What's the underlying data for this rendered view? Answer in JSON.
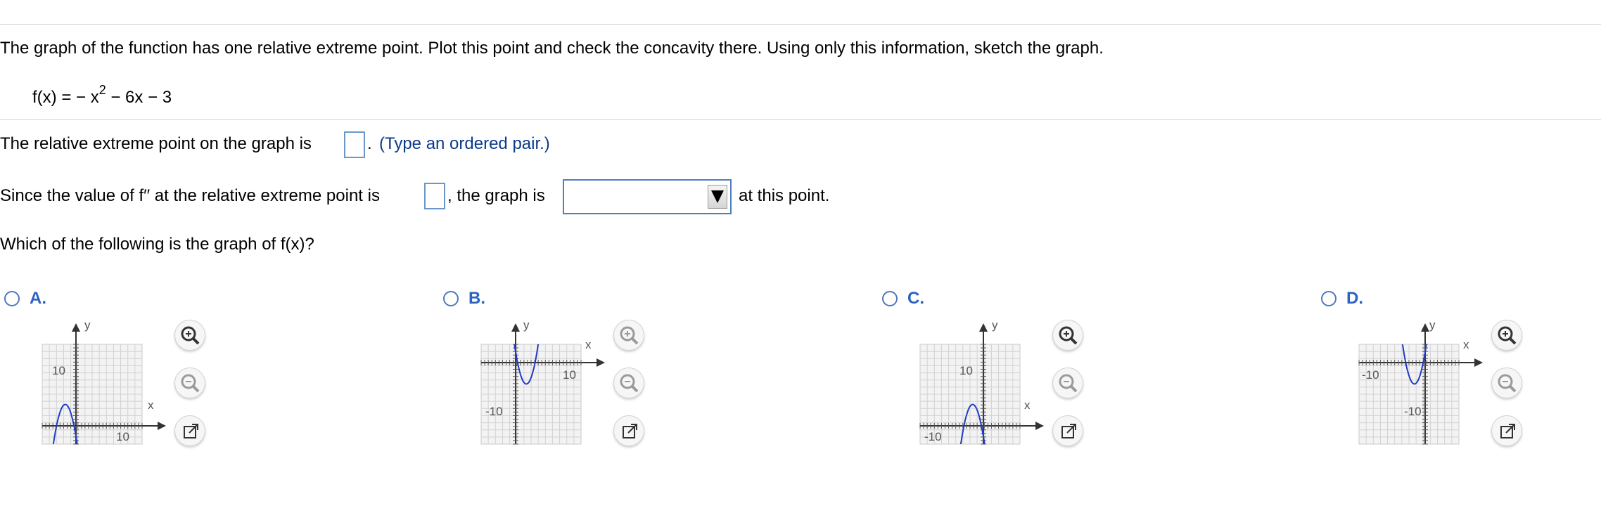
{
  "question": {
    "instructions": "The graph of the function has one relative extreme point. Plot this point and check the concavity there. Using only this information, sketch the graph.",
    "function_prefix": "f(x) =  − x",
    "function_exponent": "2",
    "function_suffix": " − 6x − 3"
  },
  "part1": {
    "prefix": "The relative extreme point on the graph is",
    "suffix": ".",
    "hint": "(Type an ordered pair.)",
    "answer_value": ""
  },
  "part2": {
    "prefix": "Since the value of f′′ at the relative extreme point is",
    "answer_value": "",
    "middle": ", the graph is",
    "dropdown_value": "",
    "suffix": "at this point."
  },
  "part3": {
    "question": "Which of the following is the graph of f(x)?"
  },
  "options": [
    {
      "letter": "A.",
      "x_axis_label": "x",
      "y_axis_label": "y",
      "tick_labels": [
        "10",
        "10"
      ],
      "curve": "down"
    },
    {
      "letter": "B.",
      "x_axis_label": "x",
      "y_axis_label": "y",
      "tick_labels": [
        "10",
        "-10"
      ],
      "curve": "up"
    },
    {
      "letter": "C.",
      "x_axis_label": "x",
      "y_axis_label": "y",
      "tick_labels": [
        "10",
        "-10"
      ],
      "curve": "down"
    },
    {
      "letter": "D.",
      "x_axis_label": "x",
      "y_axis_label": "y",
      "tick_labels": [
        "-10",
        "-10"
      ],
      "curve": "up"
    }
  ],
  "icons": {
    "zoom_in": "zoom-in-icon",
    "zoom_out": "zoom-out-icon",
    "popout": "popout-icon",
    "dropdown": "triangle-down-icon"
  },
  "colors": {
    "curve": "#1f3cc4",
    "option_label": "#2c62c1",
    "hint": "#0b3a8a",
    "answer_box_border": "#6a97c8"
  }
}
